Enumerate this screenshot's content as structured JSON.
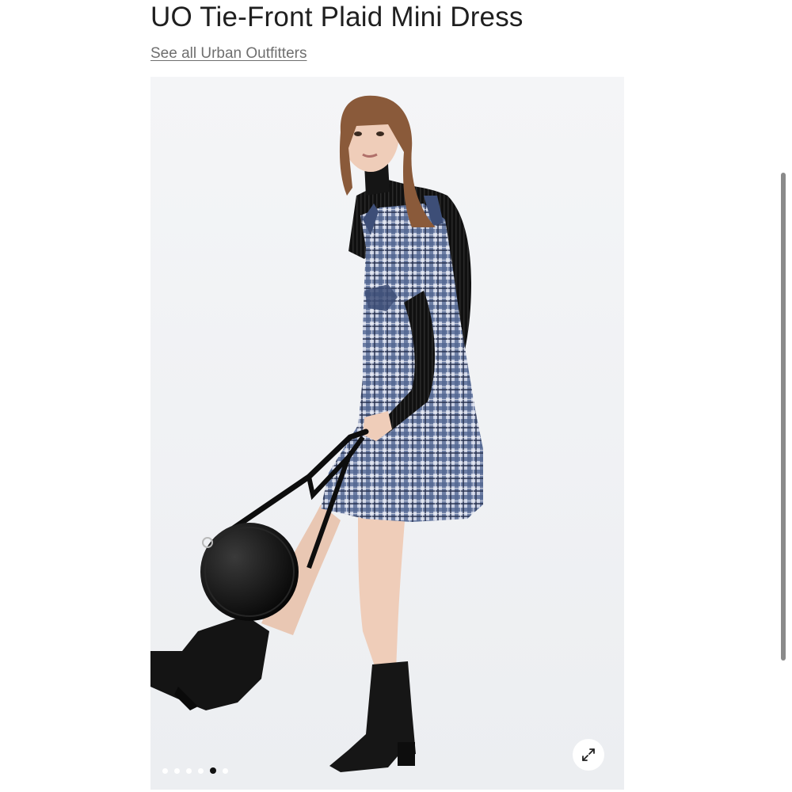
{
  "product": {
    "title": "UO Tie-Front Plaid Mini Dress",
    "brand_link": "See all Urban Outfitters"
  },
  "gallery": {
    "image_count": 6,
    "active_index": 4,
    "expand_icon": "expand-arrows-icon"
  },
  "colors": {
    "title": "#1f1f1f",
    "link": "#6f6f6f",
    "gallery_bg": "#f3f4f6",
    "dress_plaid": "#5b6f96",
    "sweater": "#111111"
  }
}
